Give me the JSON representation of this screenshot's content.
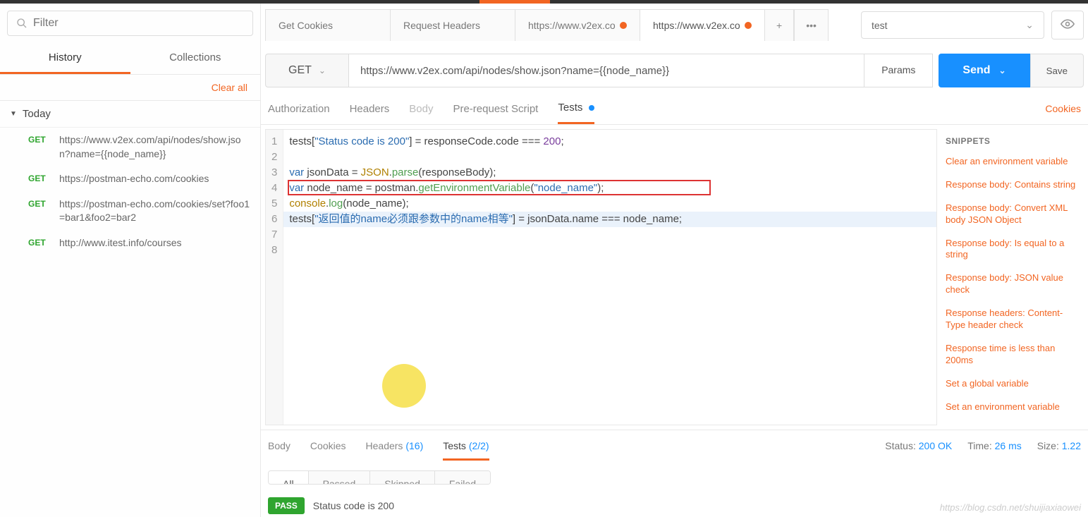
{
  "sidebar": {
    "filter_placeholder": "Filter",
    "tabs": {
      "history": "History",
      "collections": "Collections"
    },
    "clear_all": "Clear all",
    "today": "Today",
    "history": [
      {
        "method": "GET",
        "url": "https://www.v2ex.com/api/nodes/show.json?name={{node_name}}"
      },
      {
        "method": "GET",
        "url": "https://postman-echo.com/cookies"
      },
      {
        "method": "GET",
        "url": "https://postman-echo.com/cookies/set?foo1=bar1&foo2=bar2"
      },
      {
        "method": "GET",
        "url": "http://www.itest.info/courses"
      }
    ]
  },
  "tabs": [
    {
      "label": "Get Cookies",
      "dirty": false
    },
    {
      "label": "Request Headers",
      "dirty": false
    },
    {
      "label": "https://www.v2ex.co",
      "dirty": true
    },
    {
      "label": "https://www.v2ex.co",
      "dirty": true,
      "active": true
    }
  ],
  "tab_extra_plus": "+",
  "tab_extra_menu": "•••",
  "env": {
    "selected": "test"
  },
  "request": {
    "method": "GET",
    "url": "https://www.v2ex.com/api/nodes/show.json?name={{node_name}}",
    "params": "Params",
    "send": "Send",
    "save": "Save"
  },
  "inner_tabs": {
    "authorization": "Authorization",
    "headers": "Headers",
    "body": "Body",
    "prerequest": "Pre-request Script",
    "tests": "Tests"
  },
  "cookies_link": "Cookies",
  "code_fallback": "tests[\"Status code is 200\"] = responseCode.code === 200;\n\nvar jsonData = JSON.parse(responseBody);\nvar node_name = postman.getEnvironmentVariable(\"node_name\");\nconsole.log(node_name);\ntests[\"返回值的name必须跟参数中的name相等\"] = jsonData.name === node_name;\n\n",
  "code": {
    "l1": {
      "p1": "tests[",
      "s1": "\"Status code is 200\"",
      "p2": "] = responseCode.code === ",
      "n1": "200",
      "p3": ";"
    },
    "l3": {
      "k1": "var",
      "p1": " jsonData = ",
      "c1": "JSON",
      "p2": ".",
      "f1": "parse",
      "p3": "(responseBody);"
    },
    "l4": {
      "k1": "var",
      "p1": " node_name = postman.",
      "f1": "getEnvironmentVariable",
      "p2": "(",
      "s1": "\"node_name\"",
      "p3": ");"
    },
    "l5": {
      "c1": "console",
      "p1": ".",
      "f1": "log",
      "p2": "(node_name);"
    },
    "l6": {
      "p1": "tests[",
      "s1": "\"返回值的name必须跟参数中的name相等\"",
      "p2": "] = jsonData.name === node_name;"
    }
  },
  "line_numbers": [
    "1",
    "2",
    "3",
    "4",
    "5",
    "6",
    "7",
    "8"
  ],
  "snippets": {
    "title": "SNIPPETS",
    "items": [
      "Clear an environment variable",
      "Response body: Contains string",
      "Response body: Convert XML body JSON Object",
      "Response body: Is equal to a string",
      "Response body: JSON value check",
      "Response headers: Content-Type header check",
      "Response time is less than 200ms",
      "Set a global variable",
      "Set an environment variable"
    ]
  },
  "response": {
    "tabs": {
      "body": "Body",
      "cookies": "Cookies",
      "headers": "Headers",
      "headers_count": "(16)",
      "tests": "Tests",
      "tests_count": "(2/2)"
    },
    "meta": {
      "status_label": "Status:",
      "status_value": "200 OK",
      "time_label": "Time:",
      "time_value": "26 ms",
      "size_label": "Size:",
      "size_value": "1.22"
    },
    "filters": {
      "all": "All",
      "passed": "Passed",
      "skipped": "Skipped",
      "failed": "Failed"
    },
    "test_result": {
      "badge": "PASS",
      "text": "Status code is 200"
    }
  },
  "watermark": "https://blog.csdn.net/shuijiaxiaowei"
}
